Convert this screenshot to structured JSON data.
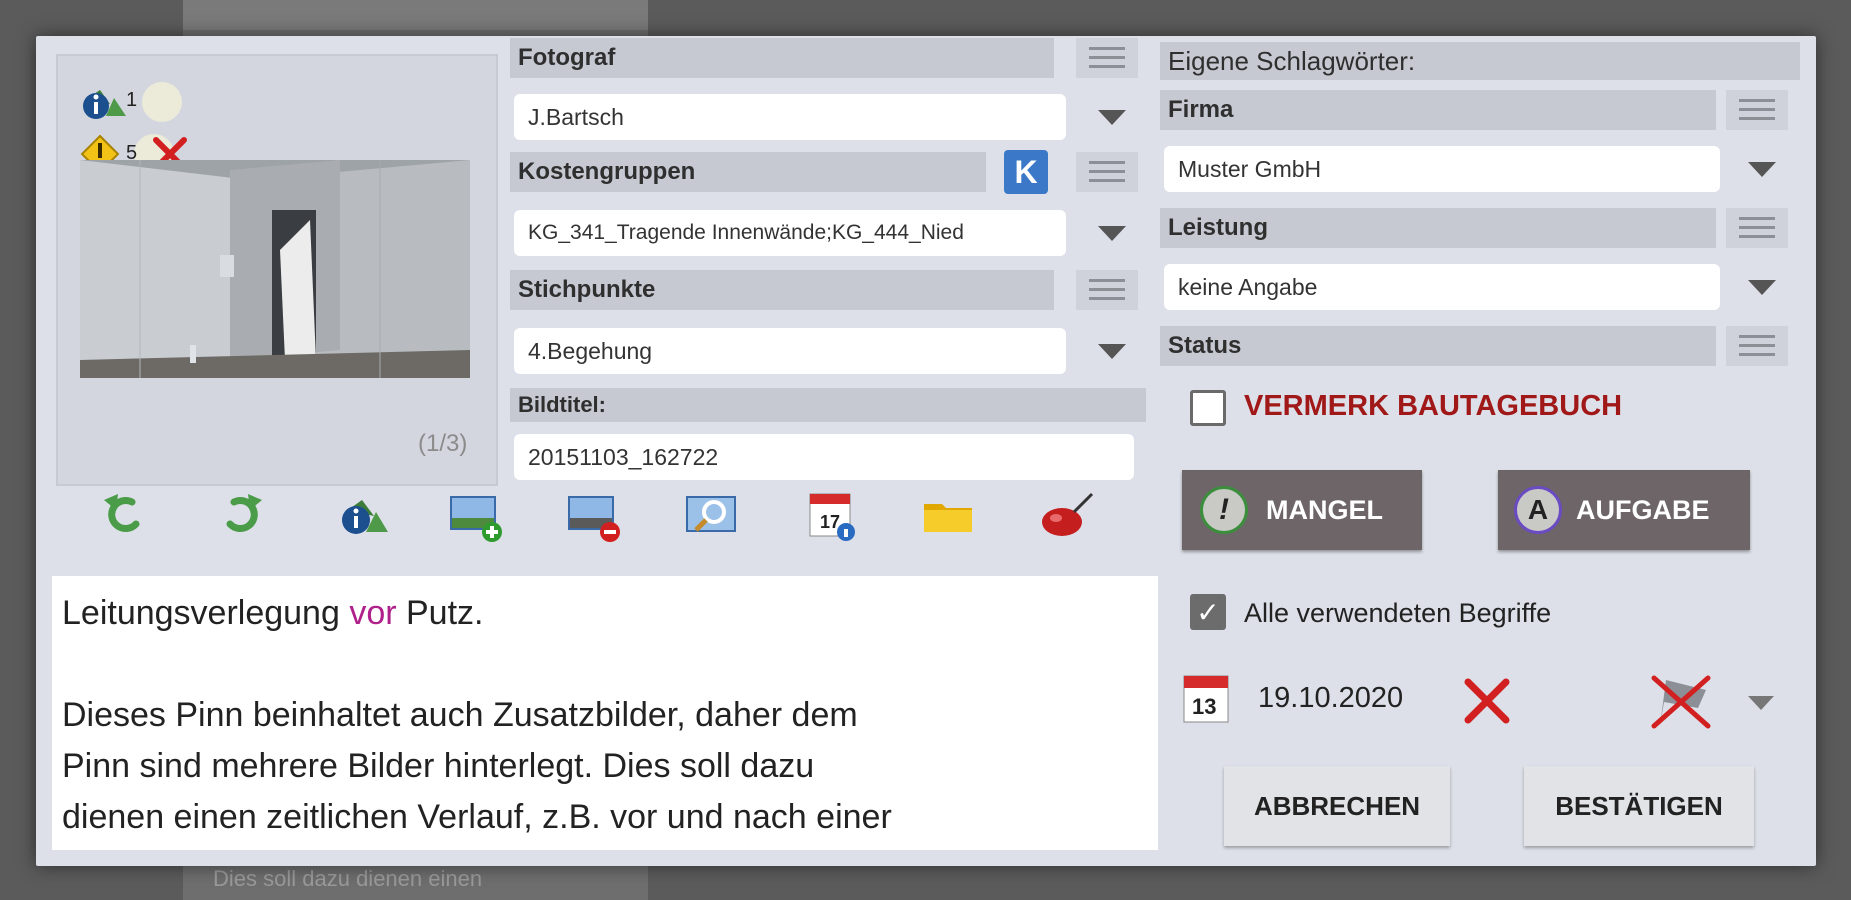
{
  "background": {
    "partial_text": "Dies soll dazu dienen einen"
  },
  "photo": {
    "badge_info_count": "1",
    "badge_warn_count": "5",
    "pager": "(1/3)"
  },
  "fotograf": {
    "label": "Fotograf",
    "value": "J.Bartsch"
  },
  "kostengruppen": {
    "label": "Kostengruppen",
    "badge": "K",
    "value": "KG_341_Tragende Innenwände;KG_444_Nied"
  },
  "stichpunkte": {
    "label": "Stichpunkte",
    "value": "4.Begehung"
  },
  "bildtitel": {
    "label": "Bildtitel:",
    "value": "20151103_162722"
  },
  "toolbar": {
    "icons": [
      "rotate-left-icon",
      "rotate-right-icon",
      "info-image-icon",
      "add-image-icon",
      "remove-image-icon",
      "zoom-image-icon",
      "calendar-info-icon",
      "folder-icon",
      "color-pin-icon"
    ]
  },
  "description": {
    "line1_a": "Leitungsverlegung ",
    "line1_b": "vor",
    "line1_c": " Putz.",
    "line2": "Dieses Pinn beinhaltet auch Zusatzbilder, daher dem",
    "line3": "Pinn sind mehrere Bilder hinterlegt. Dies soll dazu",
    "line4": "dienen einen zeitlichen Verlauf, z.B. vor und nach einer"
  },
  "keywords": {
    "title": "Eigene Schlagwörter:"
  },
  "firma": {
    "label": "Firma",
    "value": "Muster GmbH"
  },
  "leistung": {
    "label": "Leistung",
    "value": "keine Angabe"
  },
  "status": {
    "label": "Status"
  },
  "vermerk": {
    "label": "VERMERK BAUTAGEBUCH",
    "checked": false,
    "color": "#a01818"
  },
  "mangel": {
    "label": "MANGEL",
    "icon_letter": "!"
  },
  "aufgabe": {
    "label": "AUFGABE",
    "icon_letter": "A"
  },
  "alle_begriffe": {
    "label": "Alle verwendeten Begriffe",
    "checked": true
  },
  "date": {
    "value": "19.10.2020",
    "calendar_day": "13"
  },
  "actions": {
    "cancel": "ABBRECHEN",
    "confirm": "BESTÄTIGEN"
  },
  "colors": {
    "dialog_bg": "#dde0e8",
    "header_bg": "#c6c9d2",
    "button_dark": "#6d6568",
    "accent_red": "#d21f1f"
  }
}
